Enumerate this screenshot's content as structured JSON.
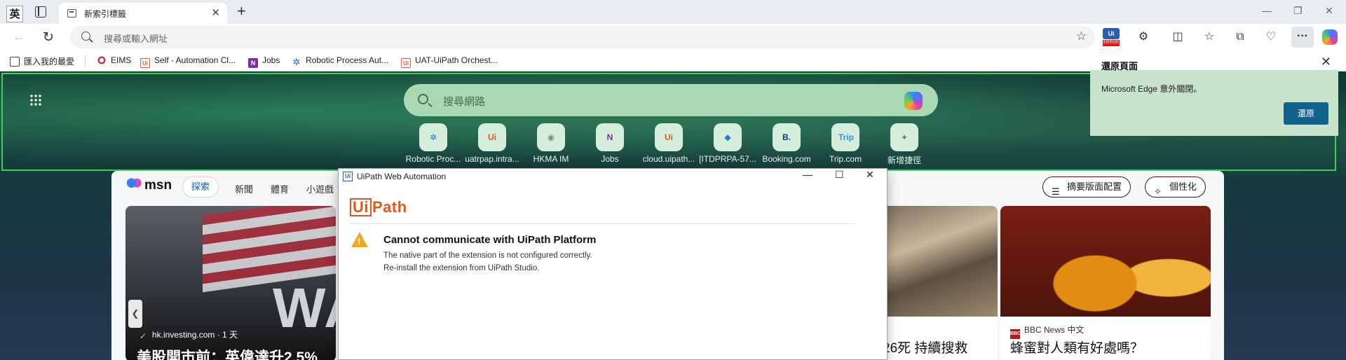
{
  "ime": {
    "label": "英"
  },
  "tab": {
    "title": "新索引標籤"
  },
  "omnibox": {
    "placeholder": "搜尋或輸入網址"
  },
  "favorites": [
    {
      "label": "匯入我的最愛",
      "icon": "import-icon"
    },
    {
      "label": "EIMS",
      "icon": "eims-icon"
    },
    {
      "label": "Self - Automation Cl...",
      "icon": "uipath-icon"
    },
    {
      "label": "Jobs",
      "icon": "onenote-icon"
    },
    {
      "label": "Robotic Process Aut...",
      "icon": "rpa-icon"
    },
    {
      "label": "UAT-UiPath Orchest...",
      "icon": "uipath-icon"
    }
  ],
  "extension_badge": {
    "top": "Ui",
    "bottom": "ERROR"
  },
  "restore_popup": {
    "title": "還原頁面",
    "message": "Microsoft Edge 意外關閉。",
    "button": "還原"
  },
  "ntp": {
    "search_placeholder": "搜尋網路",
    "quick_links": [
      {
        "label": "Robotic Proc...",
        "glyph": "✲",
        "color": "#1d6ff2"
      },
      {
        "label": "uatrpap.intra...",
        "glyph": "Ui",
        "color": "#e8541e"
      },
      {
        "label": "HKMA IM",
        "glyph": "◉",
        "color": "#888888"
      },
      {
        "label": "Jobs",
        "glyph": "N",
        "color": "#7b2ea8"
      },
      {
        "label": "cloud.uipath...",
        "glyph": "Ui",
        "color": "#e8541e"
      },
      {
        "label": "[ITDPRPA-57...",
        "glyph": "◆",
        "color": "#1d7ad8"
      },
      {
        "label": "Booking.com",
        "glyph": "B.",
        "color": "#0a3d73"
      },
      {
        "label": "Trip.com",
        "glyph": "Trip",
        "color": "#3d8cf0"
      },
      {
        "label": "新增捷徑",
        "glyph": "+",
        "color": "#4a6a52"
      }
    ]
  },
  "feed": {
    "logo": "msn",
    "tabs": [
      "探索",
      "新聞",
      "體育",
      "小遊戲"
    ],
    "layout_button": "摘要版面配置",
    "personalize_button": "個性化",
    "cards": [
      {
        "source": "hk.investing.com · 1 天",
        "headline": "美股開市前：英偉達升2.5%"
      },
      {
        "headline": "26死 持續搜救"
      },
      {
        "source": "BBC News 中文",
        "headline": "蜂蜜對人類有好處嗎？"
      }
    ]
  },
  "dialog": {
    "title": "UiPath Web Automation",
    "logo_box": "Ui",
    "logo_rest": "Path",
    "heading": "Cannot communicate with UiPath Platform",
    "line1": "The native part of the extension is not configured correctly.",
    "line2": "Re-install the extension from UiPath Studio."
  }
}
